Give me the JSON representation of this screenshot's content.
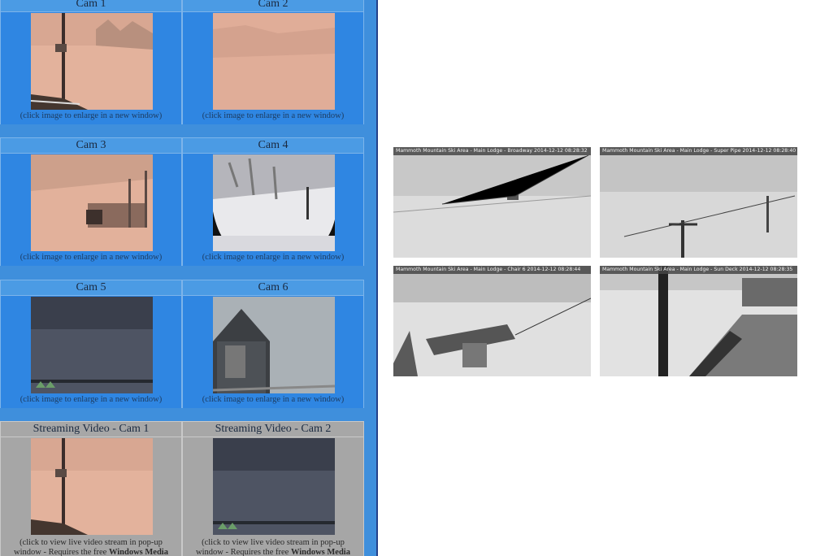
{
  "cameras": [
    {
      "title": "Cam 1",
      "caption": "(click image to enlarge in a new window)"
    },
    {
      "title": "Cam 2",
      "caption": "(click image to enlarge in a new window)"
    },
    {
      "title": "Cam 3",
      "caption": "(click image to enlarge in a new window)"
    },
    {
      "title": "Cam 4",
      "caption": "(click image to enlarge in a new window)"
    },
    {
      "title": "Cam 5",
      "caption": "(click image to enlarge in a new window)"
    },
    {
      "title": "Cam 6",
      "caption": "(click image to enlarge in a new window)"
    }
  ],
  "streams": [
    {
      "title": "Streaming Video - Cam 1",
      "caption": "(click to view live video stream in pop-up",
      "caption2": "window - Requires the free",
      "caption_bold": "Windows Media"
    },
    {
      "title": "Streaming Video - Cam 2",
      "caption": "(click to view live video stream in pop-up",
      "caption2": "window - Requires the free",
      "caption_bold": "Windows Media"
    }
  ],
  "webcams": [
    {
      "label": "Mammoth Mountain Ski Area - Main Lodge - Broadway 2014-12-12 08:28:32"
    },
    {
      "label": "Mammoth Mountain Ski Area - Main Lodge - Super Pipe 2014-12-12 08:28:40"
    },
    {
      "label": "Mammoth Mountain Ski Area - Main Lodge - Chair 6 2014-12-12 08:28:44"
    },
    {
      "label": "Mammoth Mountain Ski Area - Main Lodge - Sun Deck 2014-12-12 08:28:35"
    }
  ],
  "colors": {
    "panel_blue": "#3f8fdc",
    "panel_border": "#24408a",
    "stream_gray": "#a6a6a6"
  }
}
